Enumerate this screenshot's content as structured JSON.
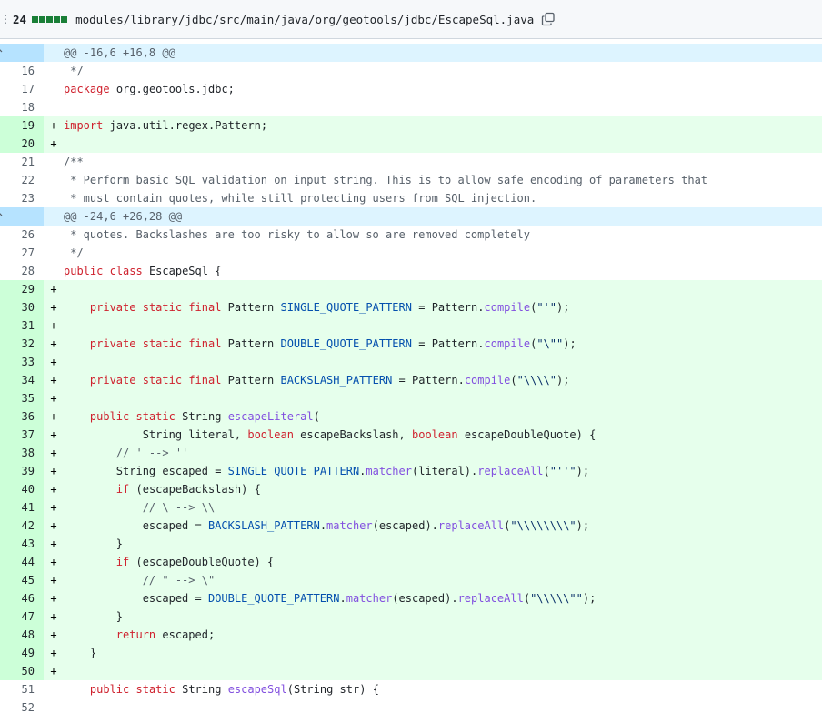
{
  "header": {
    "change_count": "24",
    "file_path": "modules/library/jdbc/src/main/java/org/geotools/jdbc/EscapeSql.java"
  },
  "hunks": [
    {
      "id": 1,
      "label": "@@ -16,6 +16,8 @@"
    },
    {
      "id": 2,
      "label": "@@ -24,6 +26,28 @@"
    }
  ],
  "lines": [
    {
      "type": "context",
      "num": "16",
      "text": " */"
    },
    {
      "type": "context",
      "num": "17",
      "text": "package org.geotools.jdbc;"
    },
    {
      "type": "context",
      "num": "18",
      "text": ""
    },
    {
      "type": "add",
      "num": "19",
      "text": "import java.util.regex.Pattern;"
    },
    {
      "type": "add",
      "num": "20",
      "text": ""
    },
    {
      "type": "context",
      "num": "21",
      "text": "/**"
    },
    {
      "type": "context",
      "num": "22",
      "text": " * Perform basic SQL validation on input string. This is to allow safe encoding of parameters that"
    },
    {
      "type": "context",
      "num": "23",
      "text": " * must contain quotes, while still protecting users from SQL injection."
    },
    {
      "type": "context",
      "num": "26",
      "text": " * quotes. Backslashes are too risky to allow so are removed completely"
    },
    {
      "type": "context",
      "num": "27",
      "text": " */"
    },
    {
      "type": "context",
      "num": "28",
      "text": "public class EscapeSql {"
    },
    {
      "type": "add",
      "num": "29",
      "text": ""
    },
    {
      "type": "add",
      "num": "30",
      "text": "    private static final Pattern SINGLE_QUOTE_PATTERN = Pattern.compile(\"'\");"
    },
    {
      "type": "add",
      "num": "31",
      "text": ""
    },
    {
      "type": "add",
      "num": "32",
      "text": "    private static final Pattern DOUBLE_QUOTE_PATTERN = Pattern.compile(\"\\\"\");"
    },
    {
      "type": "add",
      "num": "33",
      "text": ""
    },
    {
      "type": "add",
      "num": "34",
      "text": "    private static final Pattern BACKSLASH_PATTERN = Pattern.compile(\"\\\\\\\\\");"
    },
    {
      "type": "add",
      "num": "35",
      "text": ""
    },
    {
      "type": "add",
      "num": "36",
      "text": "    public static String escapeLiteral("
    },
    {
      "type": "add",
      "num": "37",
      "text": "            String literal, boolean escapeBackslash, boolean escapeDoubleQuote) {"
    },
    {
      "type": "add",
      "num": "38",
      "text": "        // ' --> ''"
    },
    {
      "type": "add",
      "num": "39",
      "text": "        String escaped = SINGLE_QUOTE_PATTERN.matcher(literal).replaceAll(\"''\");"
    },
    {
      "type": "add",
      "num": "40",
      "text": "        if (escapeBackslash) {"
    },
    {
      "type": "add",
      "num": "41",
      "text": "            // \\ --> \\\\"
    },
    {
      "type": "add",
      "num": "42",
      "text": "            escaped = BACKSLASH_PATTERN.matcher(escaped).replaceAll(\"\\\\\\\\\\\\\\\\\");"
    },
    {
      "type": "add",
      "num": "43",
      "text": "        }"
    },
    {
      "type": "add",
      "num": "44",
      "text": "        if (escapeDoubleQuote) {"
    },
    {
      "type": "add",
      "num": "45",
      "text": "            // \" --> \\\""
    },
    {
      "type": "add",
      "num": "46",
      "text": "            escaped = DOUBLE_QUOTE_PATTERN.matcher(escaped).replaceAll(\"\\\\\\\\\\\"\");"
    },
    {
      "type": "add",
      "num": "47",
      "text": "        }"
    },
    {
      "type": "add",
      "num": "48",
      "text": "        return escaped;"
    },
    {
      "type": "add",
      "num": "49",
      "text": "    }"
    },
    {
      "type": "add",
      "num": "50",
      "text": ""
    },
    {
      "type": "context",
      "num": "51",
      "text": "    public static String escapeSql(String str) {"
    },
    {
      "type": "context",
      "num": "52",
      "text": ""
    }
  ],
  "colors": {
    "add_bg": "#e6ffec",
    "add_num_bg": "#ccffd8",
    "hunk_bg": "#ddf4ff",
    "keyword": "#cf222e",
    "constant": "#0550ae",
    "function": "#8250df"
  }
}
